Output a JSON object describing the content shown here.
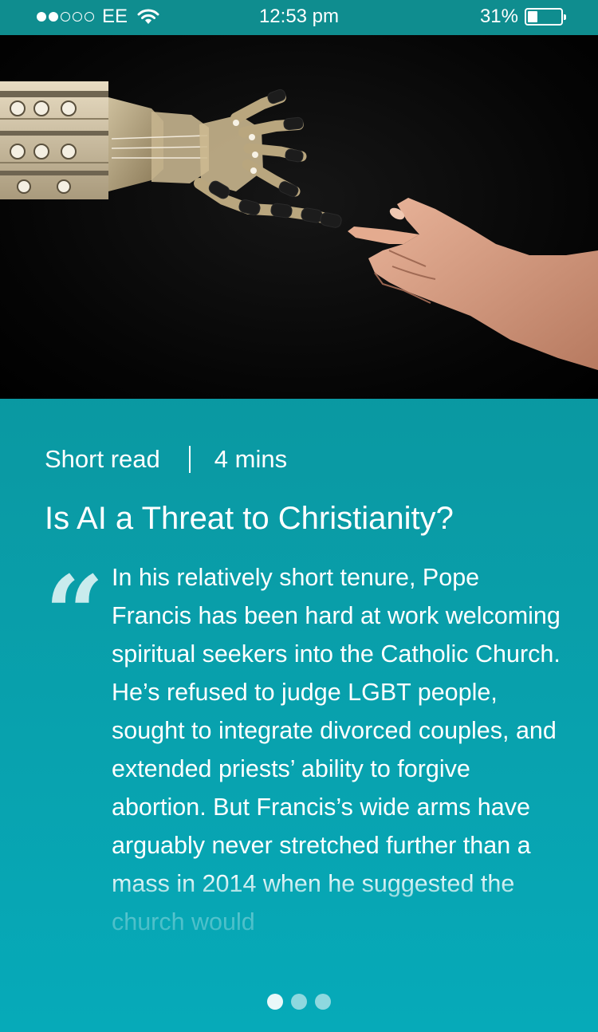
{
  "status_bar": {
    "carrier": "EE",
    "time": "12:53 pm",
    "battery": "31%",
    "battery_level": 0.31,
    "signal_strength": 2,
    "signal_max": 5,
    "icons": [
      "signal-dots-icon",
      "wifi-icon",
      "battery-icon"
    ]
  },
  "hero": {
    "image_subject": "robotic hand reaching toward human hand"
  },
  "article": {
    "type": "Short read",
    "duration": "4 mins",
    "title": "Is AI a Threat to Christianity?",
    "quote_icon": "quote-open-icon",
    "excerpt": "In his relatively short tenure, Pope Francis has been hard at work welcoming spiritual seekers into the Catholic Church. He’s refused to judge LGBT people, sought to integrate divorced couples, and extended priests’ ability to forgive abortion. But Francis’s wide arms have arguably  never stretched further than a mass in 2014 when he suggested the church would"
  },
  "pagination": {
    "total": 3,
    "current": 1
  },
  "colors": {
    "status_bar": "#0f8d8f",
    "background_top": "#0a9096",
    "background_bottom": "#06aab9",
    "text": "#ffffff",
    "quote_mark": "#c9ebed"
  }
}
